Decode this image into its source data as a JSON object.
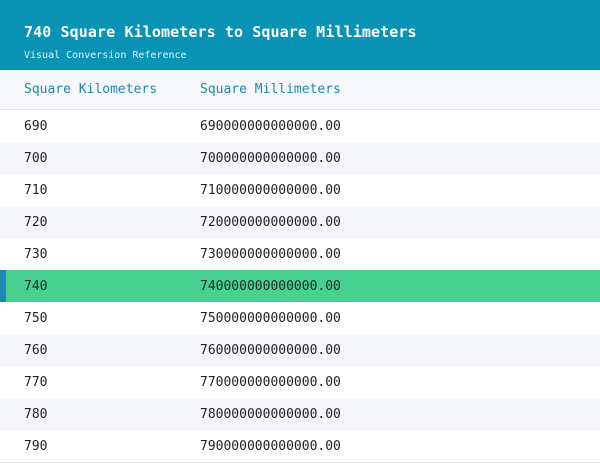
{
  "header": {
    "title": "740 Square Kilometers to Square Millimeters",
    "subtitle": "Visual Conversion Reference"
  },
  "table": {
    "columns": [
      "Square Kilometers",
      "Square Millimeters"
    ],
    "rows": [
      {
        "km2": "690",
        "mm2": "690000000000000.00"
      },
      {
        "km2": "700",
        "mm2": "700000000000000.00"
      },
      {
        "km2": "710",
        "mm2": "710000000000000.00"
      },
      {
        "km2": "720",
        "mm2": "720000000000000.00"
      },
      {
        "km2": "730",
        "mm2": "730000000000000.00"
      },
      {
        "km2": "740",
        "mm2": "740000000000000.00"
      },
      {
        "km2": "750",
        "mm2": "750000000000000.00"
      },
      {
        "km2": "760",
        "mm2": "760000000000000.00"
      },
      {
        "km2": "770",
        "mm2": "770000000000000.00"
      },
      {
        "km2": "780",
        "mm2": "780000000000000.00"
      },
      {
        "km2": "790",
        "mm2": "790000000000000.00"
      }
    ],
    "highlighted_value": "740"
  },
  "colors": {
    "header_bg": "#0a93b5",
    "highlight_row": "#47d08f",
    "highlight_marker": "#1f86b8",
    "column_header_text": "#1b8aa8"
  }
}
